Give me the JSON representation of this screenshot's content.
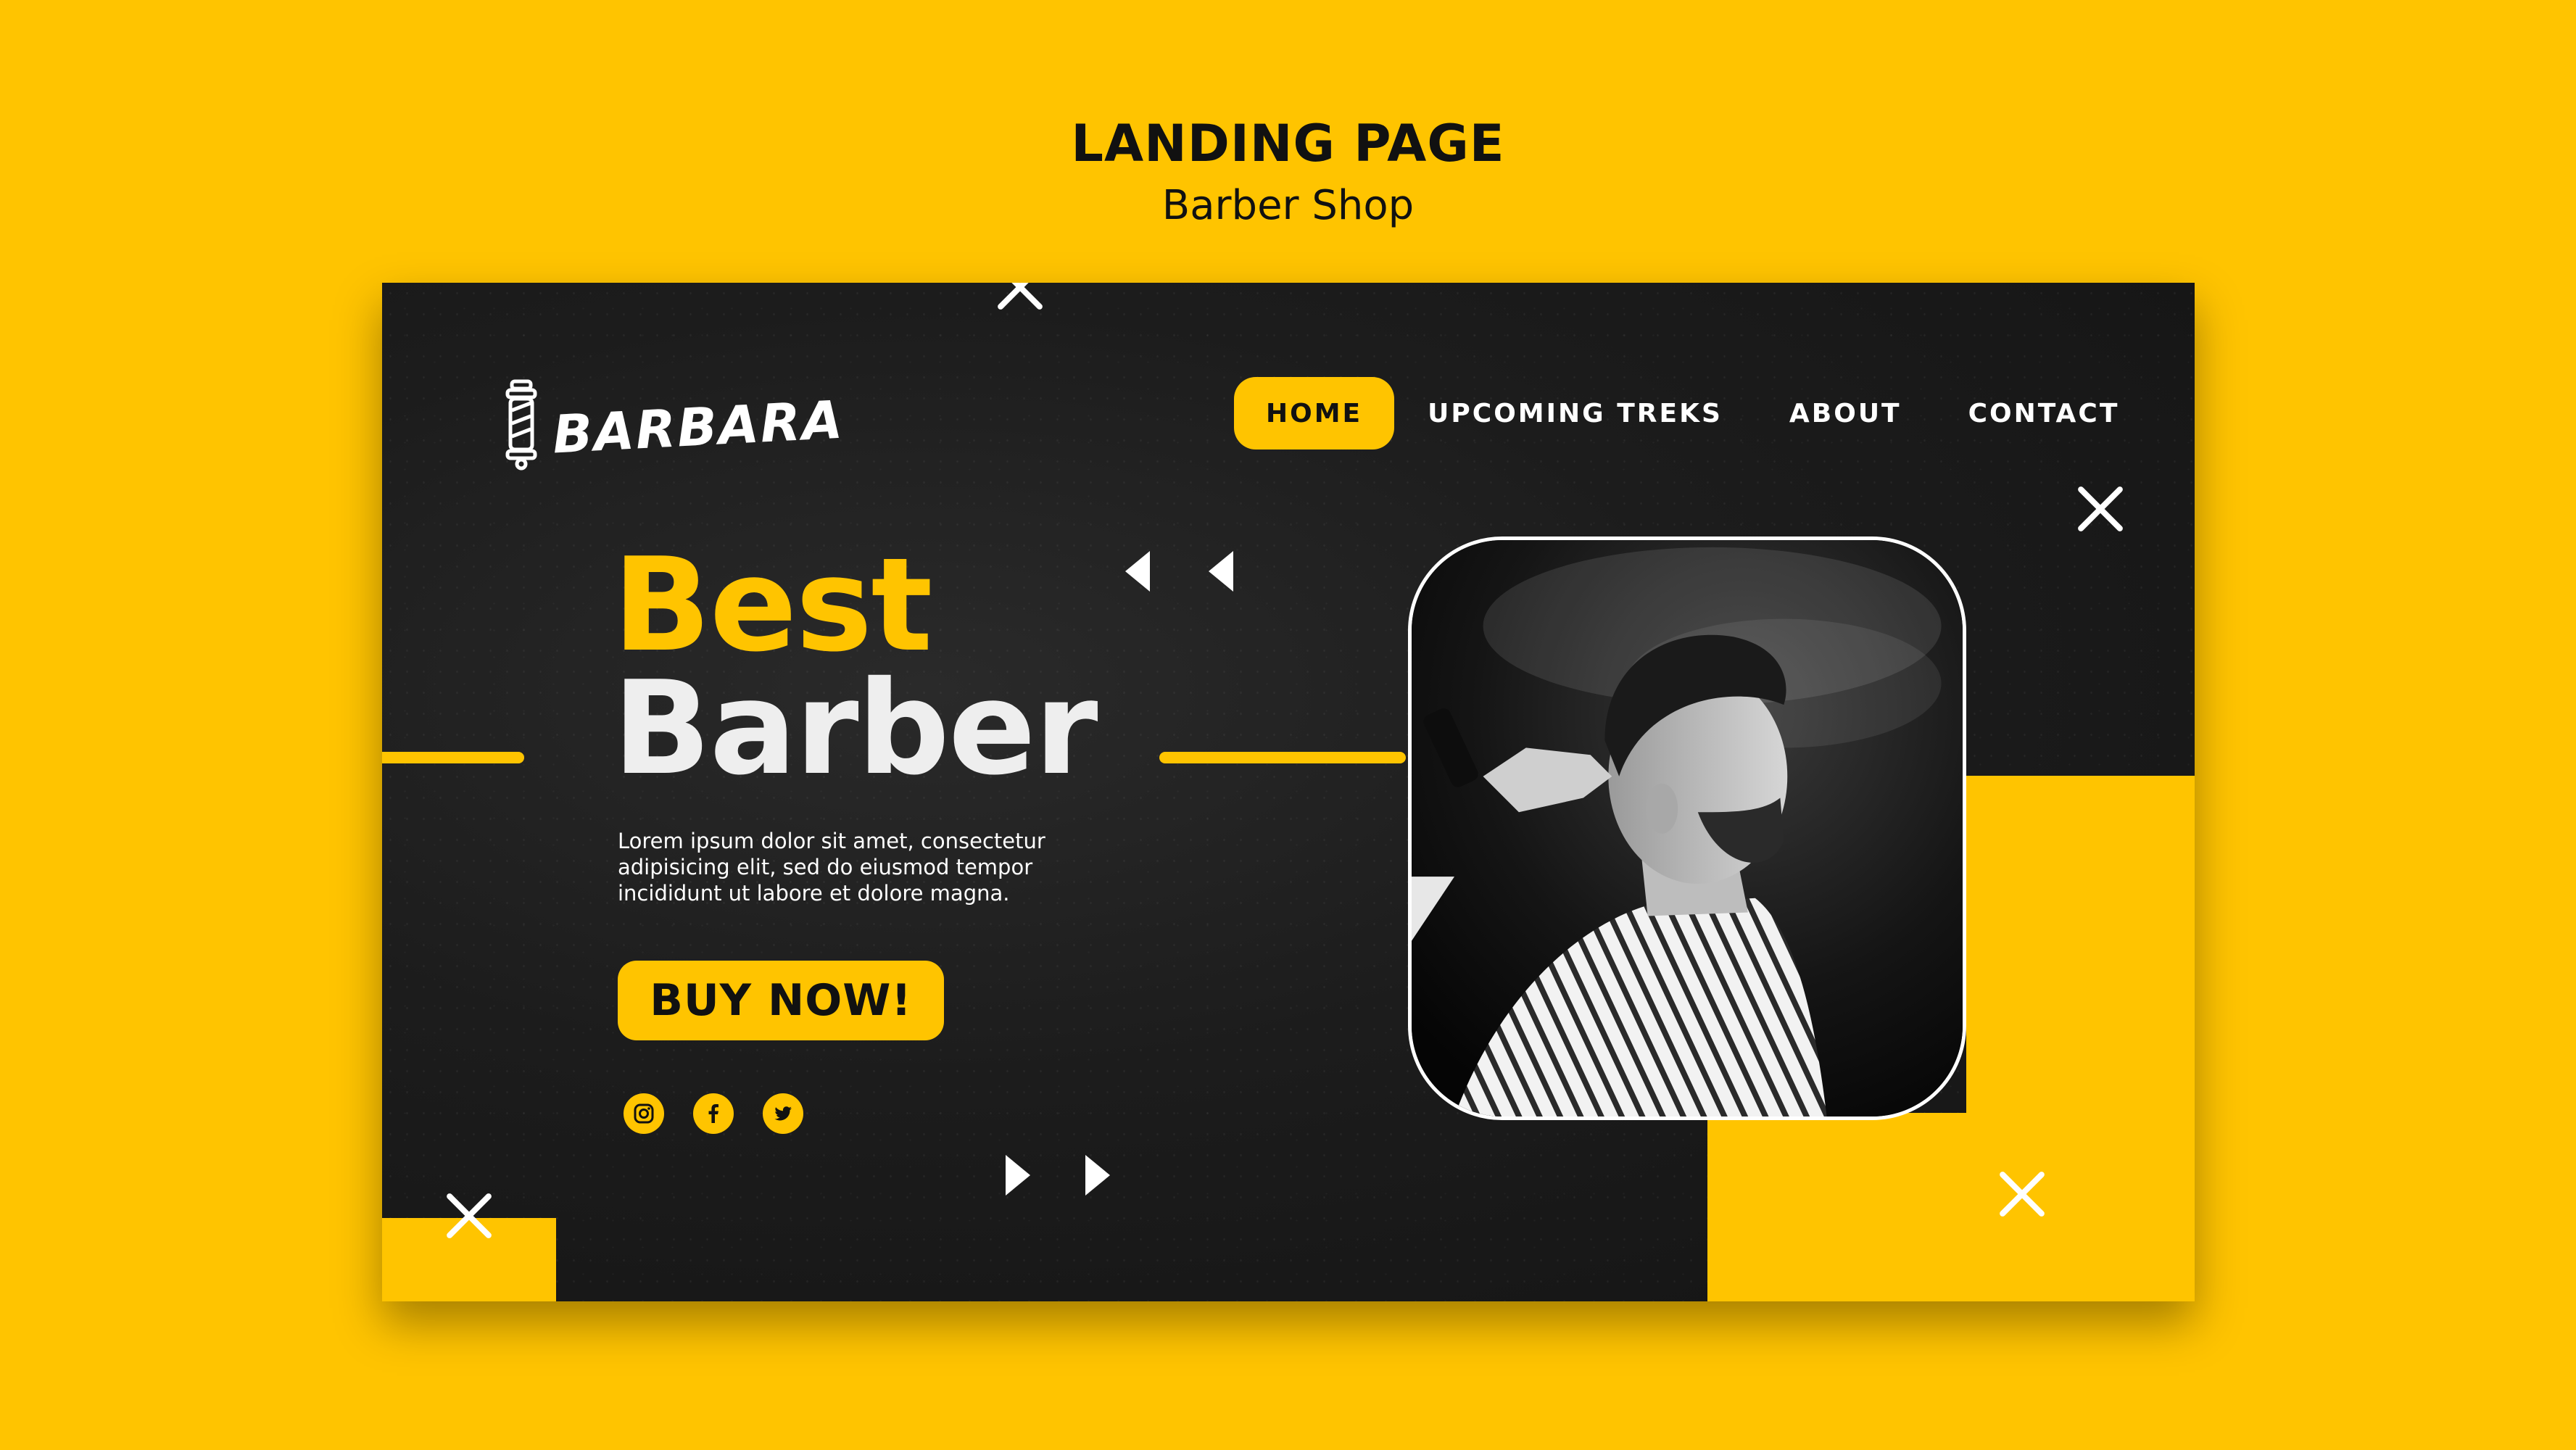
{
  "heading": {
    "title": "LANDING PAGE",
    "subtitle": "Barber Shop"
  },
  "brand": {
    "name": "BARBARA",
    "logo_icon": "barber-pole-icon"
  },
  "nav": {
    "items": [
      {
        "label": "HOME",
        "active": true
      },
      {
        "label": "UPCOMING TREKS",
        "active": false
      },
      {
        "label": "ABOUT",
        "active": false
      },
      {
        "label": "CONTACT",
        "active": false
      }
    ]
  },
  "hero": {
    "title_line1": "Best",
    "title_line2": "Barber",
    "description": "Lorem ipsum dolor sit amet, consectetur adipisicing elit, sed do eiusmod tempor incididunt ut labore et dolore magna.",
    "cta_label": "BUY NOW!",
    "image": "barber-photo"
  },
  "socials": [
    {
      "icon": "instagram-icon"
    },
    {
      "icon": "facebook-icon"
    },
    {
      "icon": "twitter-icon"
    }
  ],
  "colors": {
    "accent": "#FFC400",
    "background": "#1c1c1c",
    "text": "#ffffff",
    "dark_text": "#111111"
  }
}
